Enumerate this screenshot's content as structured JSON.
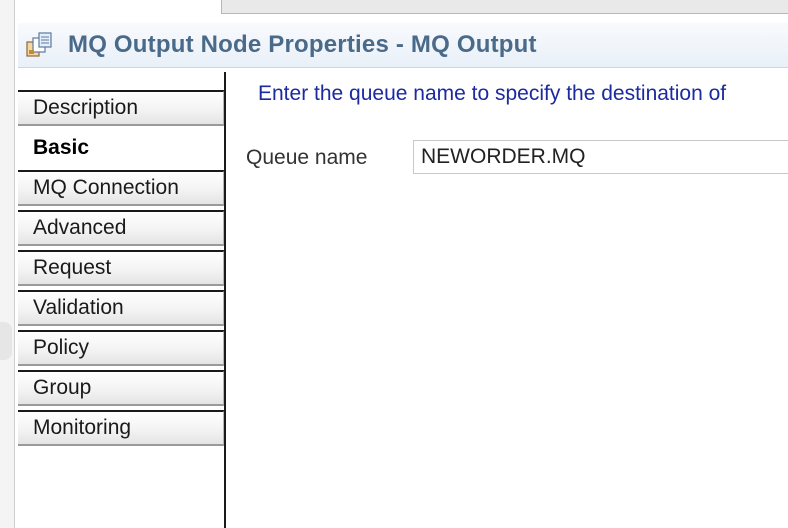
{
  "title_bar": {
    "title": "MQ Output Node Properties - MQ Output",
    "icon": "node-properties-icon",
    "text_color": "#4a6a89"
  },
  "tabs": [
    {
      "label": "Description",
      "active": false
    },
    {
      "label": "Basic",
      "active": true
    },
    {
      "label": "MQ Connection",
      "active": false
    },
    {
      "label": "Advanced",
      "active": false
    },
    {
      "label": "Request",
      "active": false
    },
    {
      "label": "Validation",
      "active": false
    },
    {
      "label": "Policy",
      "active": false
    },
    {
      "label": "Group",
      "active": false
    },
    {
      "label": "Monitoring",
      "active": false
    }
  ],
  "basic": {
    "instructions": "Enter the queue name to specify the destination of",
    "queue_name_label": "Queue name",
    "queue_name_value": "NEWORDER.MQ"
  },
  "colors": {
    "instructions_text": "#1c2aa0"
  }
}
